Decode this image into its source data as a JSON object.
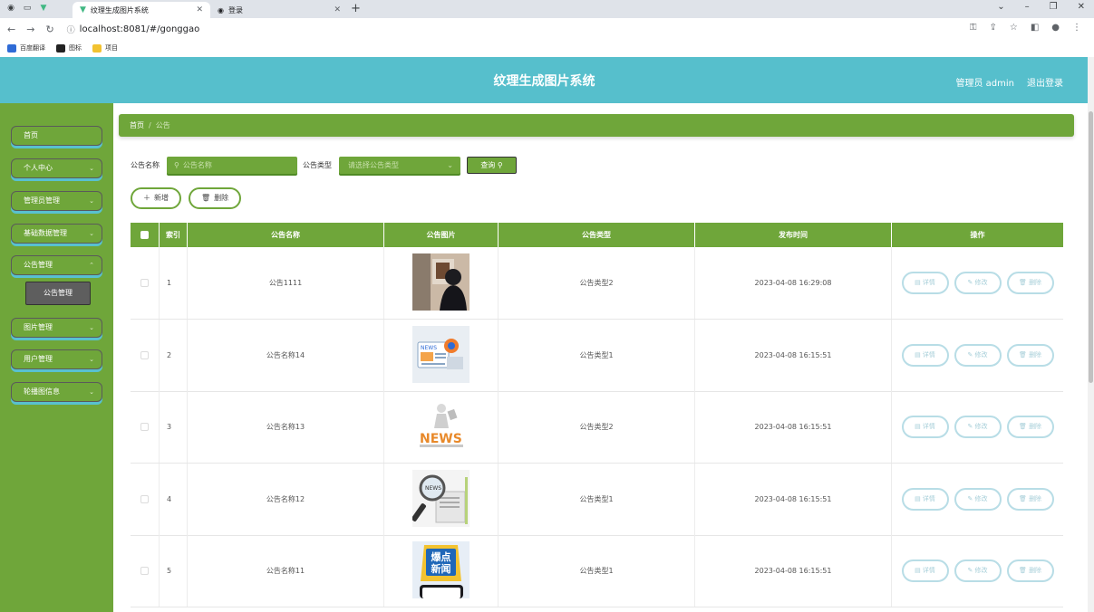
{
  "browser": {
    "tabs": [
      {
        "title": "纹理生成图片系统",
        "active": true
      },
      {
        "title": "登录",
        "active": false
      }
    ],
    "url": "localhost:8081/#/gonggao",
    "bookmarks": [
      {
        "label": "百度翻译",
        "color": "#2f6bd6"
      },
      {
        "label": "图标",
        "color": "#222222"
      },
      {
        "label": "项目",
        "color": "#f2c230"
      }
    ]
  },
  "header": {
    "title": "纹理生成图片系统",
    "role": "管理员 admin",
    "logout": "退出登录"
  },
  "sidebar": {
    "items": [
      {
        "label": "首页",
        "has_children": false
      },
      {
        "label": "个人中心",
        "has_children": true
      },
      {
        "label": "管理员管理",
        "has_children": true
      },
      {
        "label": "基础数据管理",
        "has_children": true
      },
      {
        "label": "公告管理",
        "has_children": true
      },
      {
        "label": "图片管理",
        "has_children": true
      },
      {
        "label": "用户管理",
        "has_children": true
      },
      {
        "label": "轮播图信息",
        "has_children": true
      }
    ],
    "submenu": {
      "label": "公告管理"
    }
  },
  "breadcrumb": {
    "home": "首页",
    "sep": "/",
    "current": "公告"
  },
  "search": {
    "name_label": "公告名称",
    "name_placeholder": "公告名称",
    "type_label": "公告类型",
    "type_placeholder": "请选择公告类型",
    "query_button": "查询"
  },
  "actions": {
    "add": "新增",
    "delete": "删除"
  },
  "table": {
    "headers": [
      "",
      "索引",
      "公告名称",
      "公告图片",
      "公告类型",
      "发布时间",
      "操作"
    ],
    "row_buttons": {
      "detail": "详情",
      "edit": "修改",
      "delete": "删除"
    },
    "rows": [
      {
        "index": "1",
        "name": "公告1111",
        "image": "photo-person",
        "type": "公告类型2",
        "time": "2023-04-08 16:29:08"
      },
      {
        "index": "2",
        "name": "公告名称14",
        "image": "news-flat",
        "type": "公告类型1",
        "time": "2023-04-08 16:15:51"
      },
      {
        "index": "3",
        "name": "公告名称13",
        "image": "news-3d",
        "type": "公告类型2",
        "time": "2023-04-08 16:15:51"
      },
      {
        "index": "4",
        "name": "公告名称12",
        "image": "news-magnifier",
        "type": "公告类型1",
        "time": "2023-04-08 16:15:51"
      },
      {
        "index": "5",
        "name": "公告名称11",
        "image": "breaking-news",
        "type": "公告类型1",
        "time": "2023-04-08 16:15:51"
      }
    ]
  },
  "image_text": {
    "news": "NEWS",
    "breaking_line1": "爆点",
    "breaking_line2": "新闻"
  },
  "colors": {
    "header": "#56bfcc",
    "sidebar": "#6fa63a",
    "accent": "#6fa63a"
  }
}
